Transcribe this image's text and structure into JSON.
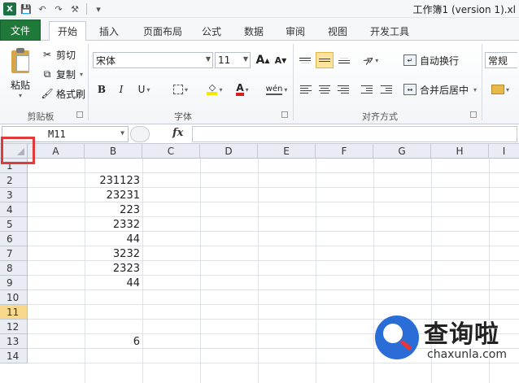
{
  "window": {
    "title": "工作簿1 (version 1).xl"
  },
  "qat": {
    "logo": "X",
    "save": "💾",
    "undo": "↶",
    "redo": "↷",
    "customize": "⚒",
    "more": "▾"
  },
  "ribbon": {
    "tabs": [
      {
        "label": "文件"
      },
      {
        "label": "开始"
      },
      {
        "label": "插入"
      },
      {
        "label": "页面布局"
      },
      {
        "label": "公式"
      },
      {
        "label": "数据"
      },
      {
        "label": "审阅"
      },
      {
        "label": "视图"
      },
      {
        "label": "开发工具"
      }
    ],
    "clipboard": {
      "paste": "粘贴",
      "cut": "剪切",
      "copy": "复制",
      "format_painter": "格式刷",
      "group": "剪贴板"
    },
    "font": {
      "name": "宋体",
      "size": "11",
      "bold": "B",
      "italic": "I",
      "underline": "U",
      "grow": "A",
      "shrink": "A",
      "font_color": "A",
      "phonetic": "wén",
      "group": "字体"
    },
    "alignment": {
      "wrap": "自动换行",
      "merge": "合并后居中",
      "group": "对齐方式"
    },
    "number": {
      "format": "常规"
    }
  },
  "formula_bar": {
    "name_box": "M11",
    "fx": "fx",
    "value": ""
  },
  "sheet": {
    "columns": [
      "A",
      "B",
      "C",
      "D",
      "E",
      "F",
      "G",
      "H",
      "I"
    ],
    "rows": [
      "1",
      "2",
      "3",
      "4",
      "5",
      "6",
      "7",
      "8",
      "9",
      "10",
      "11",
      "12",
      "13",
      "14"
    ],
    "selected_row": "11",
    "b_values": [
      "",
      "231123",
      "23231",
      "223",
      "2332",
      "44",
      "3232",
      "2323",
      "44",
      "",
      "",
      "",
      "6",
      ""
    ]
  },
  "watermark": {
    "title": "查询啦",
    "url": "chaxunla.com"
  }
}
